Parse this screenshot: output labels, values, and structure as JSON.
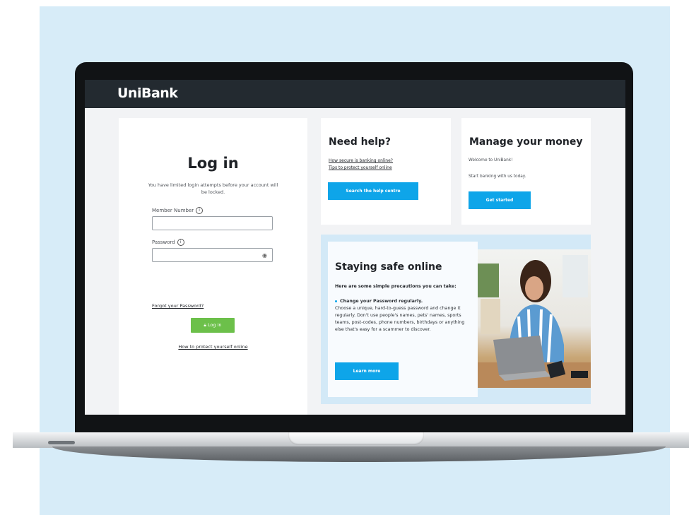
{
  "brand": {
    "name": "UniBank"
  },
  "login": {
    "title": "Log in",
    "warning": "You have limited login attempts before your account will be locked.",
    "member_label": "Member Number",
    "password_label": "Password",
    "forgot_link": "Forgot your Password?",
    "submit_label": "Log in",
    "protect_link": "How to protect yourself online"
  },
  "help": {
    "title": "Need help?",
    "links": [
      "How secure is banking online?",
      "Tips to protect yourself online"
    ],
    "button": "Search the help centre"
  },
  "manage": {
    "title": "Manage your money",
    "welcome": "Welcome to UniBank!",
    "sub": "Start banking with us today.",
    "button": "Get started"
  },
  "safe": {
    "title": "Staying safe online",
    "intro": "Here are some simple precautions you can take:",
    "bullet_title": "Change your Password regularly.",
    "bullet_body": "Choose a unique, hard-to-guess password and change it regularly. Don't use people's names, pets' names, sports teams, post-codes, phone numbers, birthdays or anything else that's easy for a scammer to discover.",
    "button": "Learn more"
  },
  "colors": {
    "accent": "#0ea5e9",
    "login_green": "#6cc04a",
    "topbar": "#232a30",
    "backdrop": "#d7ecf8"
  },
  "icons": [
    "info-icon",
    "eye-icon",
    "lock-icon"
  ]
}
